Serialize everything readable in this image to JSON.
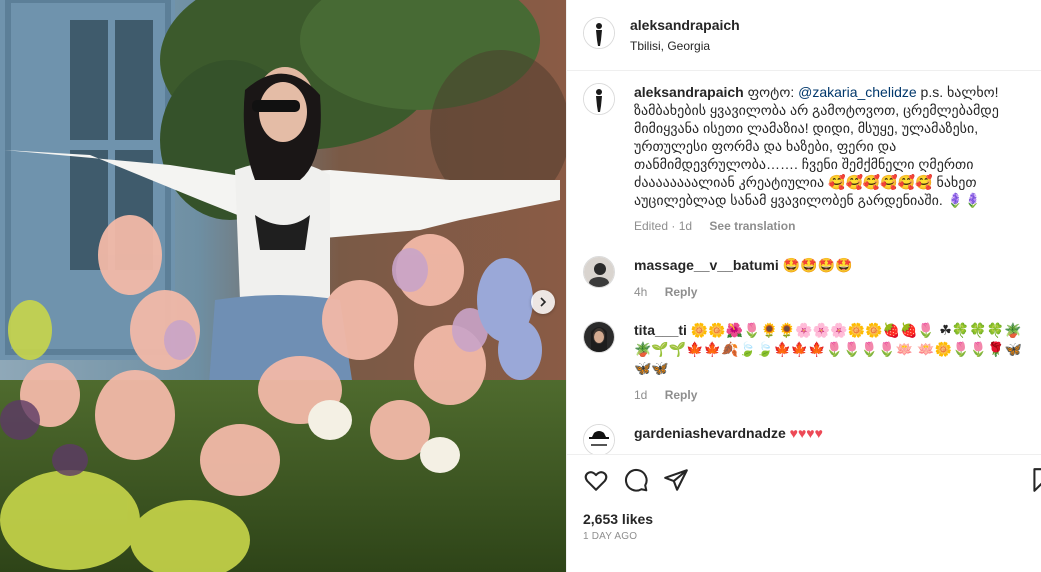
{
  "post": {
    "username": "aleksandrapaich",
    "location": "Tbilisi, Georgia",
    "caption_author": "aleksandrapaich",
    "caption_prefix": "ფოტო:",
    "caption_mention": "@zakaria_chelidze",
    "caption_text": "p.s. ხალხო! ზამბახების ყვავილობა არ გამოტოვოთ, ცრემლებამდე მიმიყვანა ისეთი ლამაზია! დიდი, მსუყე, ულამაზესი, ურთულესი ფორმა და ხაზები, ფერი და თანმიმდევრულობა……. ჩვენი შემქმნელი ღმერთი ძაააააააალიან კრეატიულია 🥰🥰🥰🥰🥰🥰 ნახეთ აუცილებლად სანამ ყვავილობენ გარდენიაში. 🪻🪻",
    "caption_edited": "Edited · 1d",
    "see_translation": "See translation",
    "likes": "2,653 likes",
    "time_ago": "1 DAY AGO"
  },
  "comments": [
    {
      "username": "massage__v__batumi",
      "text": "🤩🤩🤩🤩",
      "time": "4h",
      "reply": "Reply"
    },
    {
      "username": "tita___ti",
      "text": "🌼🌼🌺🌷🌻🌻🌸🌸🌸🌼🌼🍓🍓🌷 ☘🍀🍀🍀🪴🪴🌱🌱🍁🍁🍂🍃🍃🍁🍁🍁🌷🌷🌷🌷🪷 🪷🌼🌷🌷🌹🦋🦋🦋",
      "time": "1d",
      "reply": "Reply"
    },
    {
      "username": "gardeniashevardnadze",
      "text": "♥♥♥♥"
    }
  ],
  "icons": {
    "like": "heart-icon",
    "comment": "comment-icon",
    "share": "share-icon",
    "save": "bookmark-icon",
    "next": "chevron-right-icon"
  },
  "colors": {
    "link": "#00376b",
    "muted": "#8e8e8e",
    "heart_red": "#ed4956"
  }
}
